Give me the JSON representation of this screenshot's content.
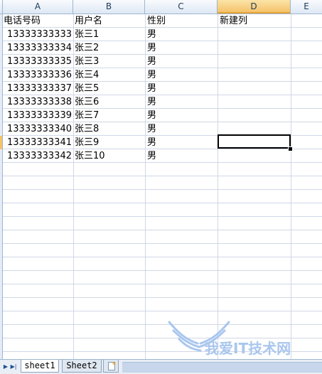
{
  "columns": [
    "A",
    "B",
    "C",
    "D",
    "E"
  ],
  "headers_row": {
    "A": "电话号码",
    "B": "用户名",
    "C": "性别",
    "D": "新建列"
  },
  "rows": [
    {
      "phone": "13333333333",
      "name": "张三1",
      "gender": "男"
    },
    {
      "phone": "13333333334",
      "name": "张三2",
      "gender": "男"
    },
    {
      "phone": "13333333335",
      "name": "张三3",
      "gender": "男"
    },
    {
      "phone": "13333333336",
      "name": "张三4",
      "gender": "男"
    },
    {
      "phone": "13333333337",
      "name": "张三5",
      "gender": "男"
    },
    {
      "phone": "13333333338",
      "name": "张三6",
      "gender": "男"
    },
    {
      "phone": "13333333339",
      "name": "张三7",
      "gender": "男"
    },
    {
      "phone": "13333333340",
      "name": "张三8",
      "gender": "男"
    },
    {
      "phone": "13333333341",
      "name": "张三9",
      "gender": "男"
    },
    {
      "phone": "13333333342",
      "name": "张三10",
      "gender": "男"
    }
  ],
  "selected_cell": "D10",
  "sheet_tabs": [
    "sheet1",
    "Sheet2"
  ],
  "active_tab": "sheet1",
  "watermark_text": "我爱IT技术网",
  "watermark_subtext": "www.52ij.com",
  "colors": {
    "header_bg": "#dde8f4",
    "active_header": "#f5c36a",
    "grid": "#d0d7e5",
    "watermark": "#a9c6ee"
  }
}
